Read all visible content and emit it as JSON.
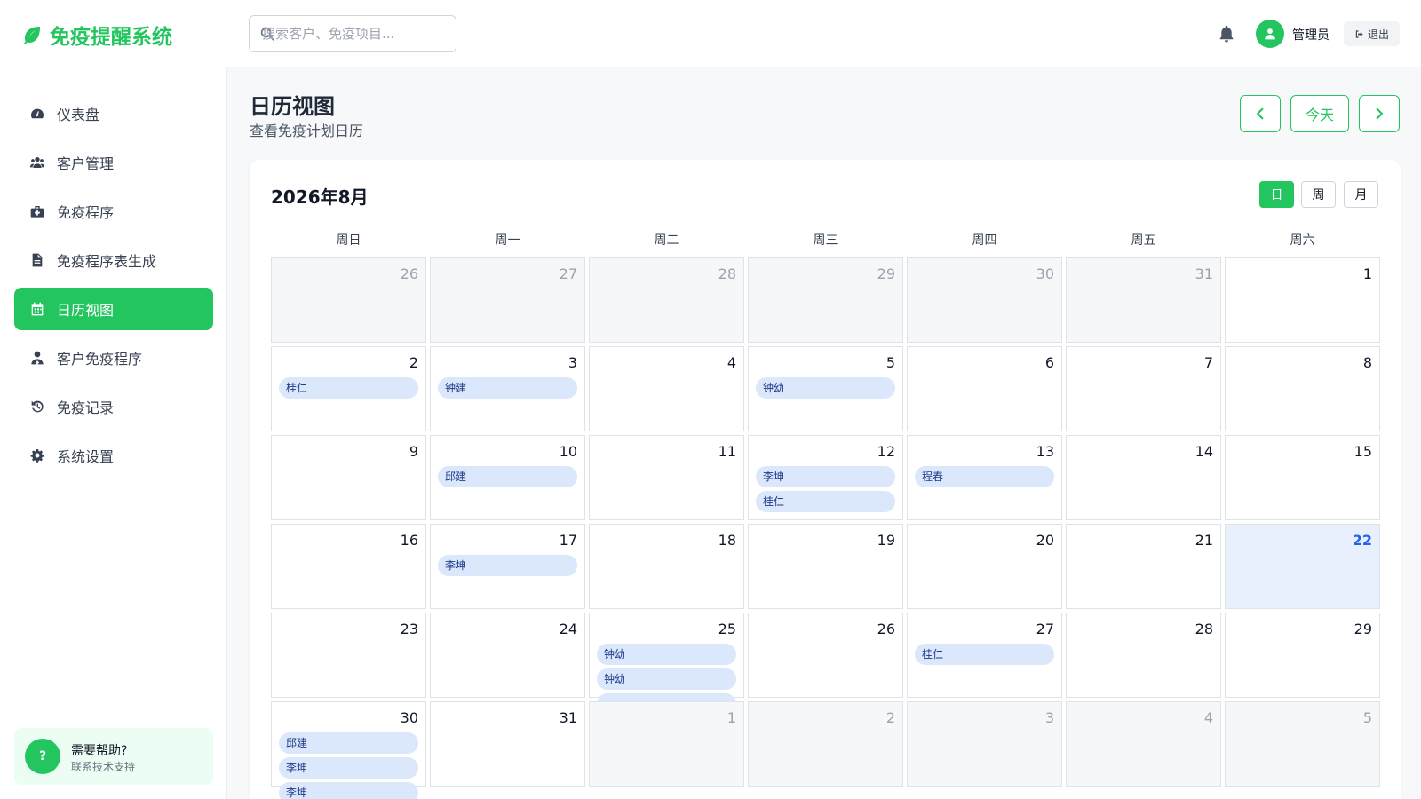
{
  "header": {
    "brand": "免疫提醒系统",
    "search_placeholder": "搜索客户、免疫项目...",
    "user_name": "管理员",
    "logout_label": "退出"
  },
  "sidebar": {
    "items": [
      {
        "label": "仪表盘",
        "icon": "dashboard-icon"
      },
      {
        "label": "客户管理",
        "icon": "users-icon"
      },
      {
        "label": "免疫程序",
        "icon": "medkit-icon"
      },
      {
        "label": "免疫程序表生成",
        "icon": "file-icon"
      },
      {
        "label": "日历视图",
        "icon": "calendar-icon"
      },
      {
        "label": "客户免疫程序",
        "icon": "user-doctor-icon"
      },
      {
        "label": "免疫记录",
        "icon": "history-icon"
      },
      {
        "label": "系统设置",
        "icon": "gear-icon"
      }
    ],
    "active_index": 4,
    "help": {
      "badge": "?",
      "title": "需要帮助?",
      "subtitle": "联系技术支持"
    }
  },
  "page": {
    "title": "日历视图",
    "subtitle": "查看免疫计划日历",
    "today_label": "今天"
  },
  "calendar": {
    "month_title": "2026年8月",
    "views": [
      "日",
      "周",
      "月"
    ],
    "active_view": 0,
    "weekdays": [
      "周日",
      "周一",
      "周二",
      "周三",
      "周四",
      "周五",
      "周六"
    ],
    "weeks": [
      [
        {
          "day": "26",
          "other": true,
          "events": []
        },
        {
          "day": "27",
          "other": true,
          "events": []
        },
        {
          "day": "28",
          "other": true,
          "events": []
        },
        {
          "day": "29",
          "other": true,
          "events": []
        },
        {
          "day": "30",
          "other": true,
          "events": []
        },
        {
          "day": "31",
          "other": true,
          "events": []
        },
        {
          "day": "1",
          "events": []
        }
      ],
      [
        {
          "day": "2",
          "events": [
            "桂仁"
          ]
        },
        {
          "day": "3",
          "events": [
            "钟建"
          ]
        },
        {
          "day": "4",
          "events": []
        },
        {
          "day": "5",
          "events": [
            "钟幼"
          ]
        },
        {
          "day": "6",
          "events": []
        },
        {
          "day": "7",
          "events": []
        },
        {
          "day": "8",
          "events": []
        }
      ],
      [
        {
          "day": "9",
          "events": []
        },
        {
          "day": "10",
          "events": [
            "邱建"
          ]
        },
        {
          "day": "11",
          "events": []
        },
        {
          "day": "12",
          "events": [
            "李坤",
            "桂仁"
          ]
        },
        {
          "day": "13",
          "events": [
            "程春"
          ]
        },
        {
          "day": "14",
          "events": []
        },
        {
          "day": "15",
          "events": []
        }
      ],
      [
        {
          "day": "16",
          "events": []
        },
        {
          "day": "17",
          "events": [
            "李坤"
          ]
        },
        {
          "day": "18",
          "events": []
        },
        {
          "day": "19",
          "events": []
        },
        {
          "day": "20",
          "events": []
        },
        {
          "day": "21",
          "events": []
        },
        {
          "day": "22",
          "today": true,
          "events": []
        }
      ],
      [
        {
          "day": "23",
          "events": []
        },
        {
          "day": "24",
          "events": []
        },
        {
          "day": "25",
          "events": [
            "钟幼",
            "钟幼",
            ""
          ]
        },
        {
          "day": "26",
          "events": []
        },
        {
          "day": "27",
          "events": [
            "桂仁"
          ]
        },
        {
          "day": "28",
          "events": []
        },
        {
          "day": "29",
          "events": []
        }
      ],
      [
        {
          "day": "30",
          "events": [
            "邱建",
            "李坤",
            "李坤"
          ]
        },
        {
          "day": "31",
          "events": []
        },
        {
          "day": "1",
          "other": true,
          "events": []
        },
        {
          "day": "2",
          "other": true,
          "events": []
        },
        {
          "day": "3",
          "other": true,
          "events": []
        },
        {
          "day": "4",
          "other": true,
          "events": []
        },
        {
          "day": "5",
          "other": true,
          "events": []
        }
      ]
    ]
  },
  "colors": {
    "accent": "#22c55e",
    "event_bg": "#dbe7fb",
    "event_text": "#1e3a8a",
    "today_bg": "#e8f0fd",
    "today_text": "#2563eb"
  }
}
